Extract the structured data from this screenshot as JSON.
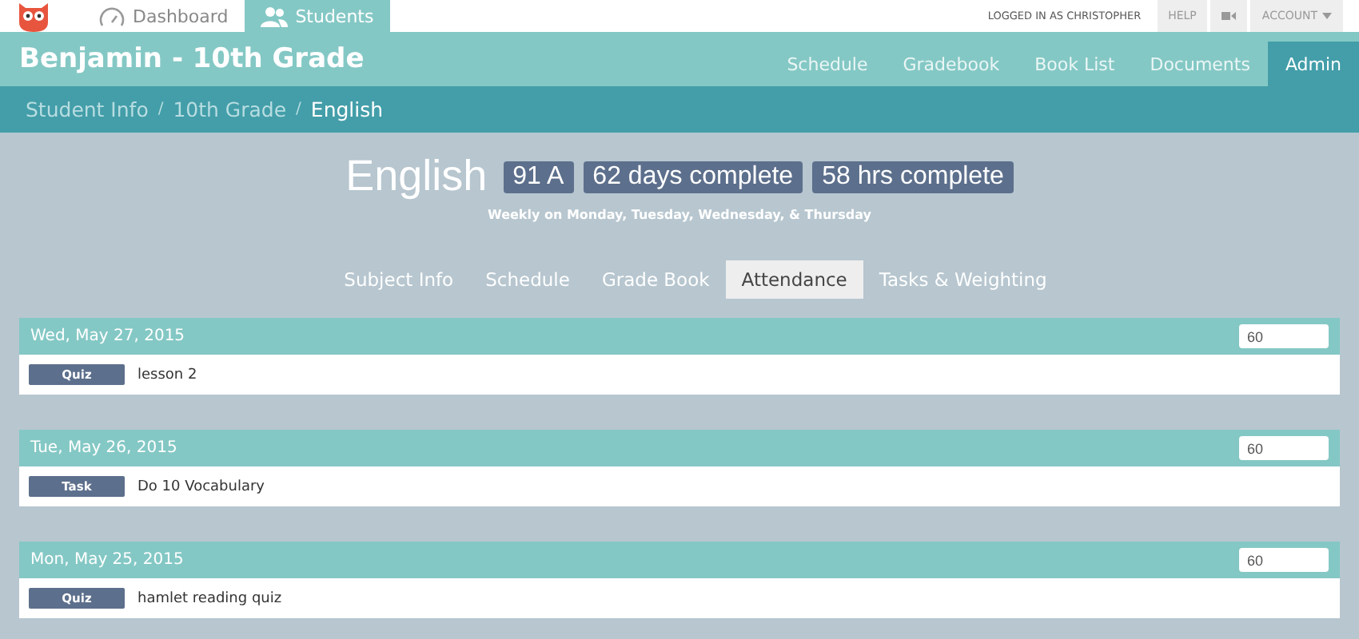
{
  "top_nav": {
    "tabs": [
      {
        "label": "Dashboard",
        "kind": "gauge",
        "selected": false
      },
      {
        "label": "Students",
        "kind": "users",
        "selected": true
      }
    ],
    "user": "LOGGED IN AS CHRISTOPHER",
    "help": "HELP",
    "account": "ACCOUNT"
  },
  "header": {
    "title": "Benjamin - 10th Grade",
    "nav": [
      {
        "label": "Schedule",
        "selected": false
      },
      {
        "label": "Gradebook",
        "selected": false
      },
      {
        "label": "Book List",
        "selected": false
      },
      {
        "label": "Documents",
        "selected": false
      },
      {
        "label": "Admin",
        "selected": true
      }
    ]
  },
  "breadcrumb": [
    {
      "label": "Student Info",
      "separator": "/"
    },
    {
      "label": "10th Grade",
      "separator": "/"
    },
    {
      "label": "English"
    }
  ],
  "subject": {
    "name": "English",
    "badges": [
      "91 A",
      "62 days complete",
      "58 hrs complete"
    ],
    "schedule": "Weekly on Monday, Tuesday, Wednesday, & Thursday"
  },
  "tabs": [
    {
      "label": "Subject Info",
      "selected": false
    },
    {
      "label": "Schedule",
      "selected": false
    },
    {
      "label": "Grade Book",
      "selected": false
    },
    {
      "label": "Attendance",
      "selected": true
    },
    {
      "label": "Tasks & Weighting",
      "selected": false
    }
  ],
  "days": [
    {
      "date": "Wed, May 27, 2015",
      "minutes": "60",
      "items": [
        {
          "type": "Quiz",
          "title": "lesson 2"
        }
      ]
    },
    {
      "date": "Tue, May 26, 2015",
      "minutes": "60",
      "items": [
        {
          "type": "Task",
          "title": "Do 10 Vocabulary"
        }
      ]
    },
    {
      "date": "Mon, May 25, 2015",
      "minutes": "60",
      "items": [
        {
          "type": "Quiz",
          "title": "hamlet reading quiz"
        }
      ]
    }
  ]
}
